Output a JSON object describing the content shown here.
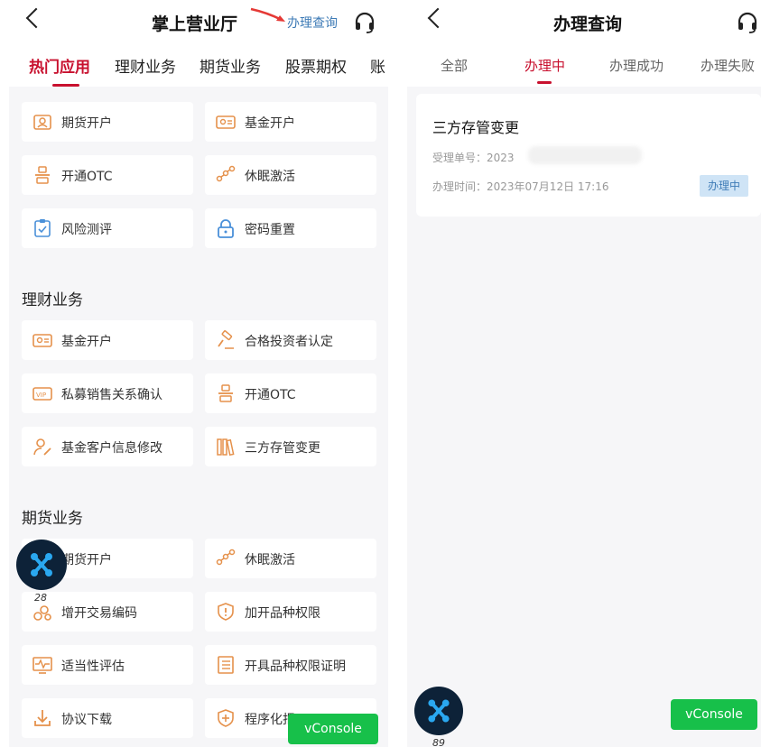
{
  "left": {
    "title": "掌上营业厅",
    "query_link": "办理查询",
    "tabs": [
      "热门应用",
      "理财业务",
      "期货业务",
      "股票期权",
      "账"
    ],
    "hot": [
      "期货开户",
      "基金开户",
      "开通OTC",
      "休眠激活",
      "风险测评",
      "密码重置"
    ],
    "section_finance": "理财业务",
    "finance": [
      "基金开户",
      "合格投资者认定",
      "私募销售关系确认",
      "开通OTC",
      "基金客户信息修改",
      "三方存管变更"
    ],
    "section_futures": "期货业务",
    "futures": [
      "期货开户",
      "休眠激活",
      "增开交易编码",
      "加开品种权限",
      "适当性评估",
      "开具品种权限证明",
      "协议下载",
      "程序化报"
    ],
    "float_count": "28",
    "vconsole": "vConsole"
  },
  "right": {
    "title": "办理查询",
    "tabs": [
      "全部",
      "办理中",
      "办理成功",
      "办理失败"
    ],
    "record": {
      "title": "三方存管变更",
      "order_label": "受理单号：2023",
      "time": "办理时间：2023年07月12日 17:16",
      "status": "办理中"
    },
    "float_count": "89",
    "vconsole": "vConsole"
  },
  "colors": {
    "accent": "#c8102e",
    "icon": "#e5914b",
    "vconsole": "#17c04a",
    "badge_bg": "#cfe4f6"
  }
}
